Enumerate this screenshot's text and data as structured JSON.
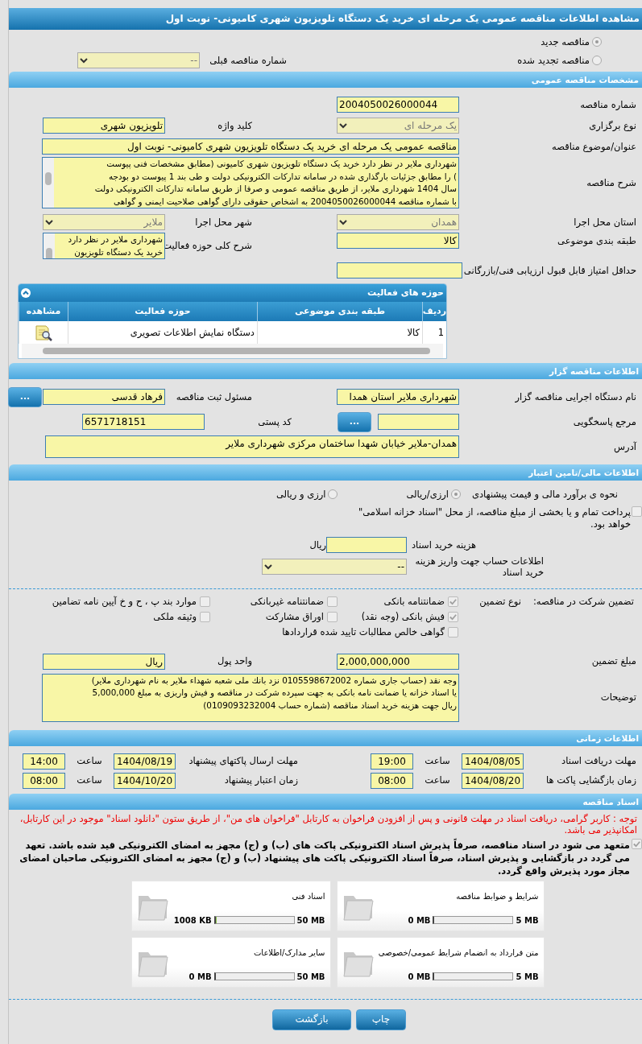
{
  "title": "مشاهده اطلاعات مناقصه عمومی یک مرحله ای خرید یک دستگاه تلویزیون شهری کامیونی- نوبت اول",
  "tender_status": [
    {
      "label": "مناقصه جدید",
      "selected": true
    },
    {
      "label": "مناقصه تجدید شده",
      "selected": false
    }
  ],
  "previous_tender": {
    "label": "شماره مناقصه قبلی",
    "value": "--"
  },
  "general": {
    "heading": "مشخصات مناقصه عمومی",
    "number": {
      "label": "شماره مناقصه",
      "value": "2004050026000044"
    },
    "holding_type": {
      "label": "نوع برگزاری",
      "value": "یک مرحله ای"
    },
    "keyword": {
      "label": "کلید واژه",
      "value": "تلویزیون شهری"
    },
    "subject": {
      "label": "عنوان/موضوع مناقصه",
      "value": "مناقصه عمومی یک مرحله ای  خرید یک دستگاه تلویزیون شهری کامیونی-  نوبت اول"
    },
    "description": {
      "label": "شرح مناقصه",
      "lines": [
        "شهرداری ملایر در نظر دارد  خرید یک دستگاه تلویزیون شهری کامیونی (مطابق مشخصات فنی پیوست",
        ") را مطابق جزئیات بارگذاری شده در سامانه تدارکات الکترونیکی دولت و طی بند 1 پیوست دو بودجه",
        "سال 1404 شهرداری ملایر، از طریق مناقصه عمومی و صرفا از طریق سامانه تدارکات الکترونیکی دولت",
        "با شماره مناقصه 2004050026000044 به اشخاص حقوقی دارای گواهی صلاحیت ایمنی و گواهی"
      ]
    },
    "province": {
      "label": "استان محل اجرا",
      "value": "همدان"
    },
    "city": {
      "label": "شهر محل اجرا",
      "value": "ملایر"
    },
    "category": {
      "label": "طبقه بندی موضوعی",
      "value": "کالا"
    },
    "activity_description": {
      "label": "شرح کلی حوزه فعالیت",
      "lines": [
        "شهرداری ملایر در نظر دارد",
        "خرید یک دستگاه تلویزیون"
      ]
    },
    "min_score": {
      "label": "حداقل امتیاز قابل قبول ارزیابی فنی/بازرگانی"
    },
    "activities": {
      "title": "حوزه های فعالیت",
      "columns": [
        "ردیف",
        "طبقه بندی موضوعی",
        "حوزه فعالیت",
        "مشاهده"
      ],
      "rows": [
        {
          "index": "1",
          "category": "کالا",
          "field": "دستگاه نمایش اطلاعات تصویری"
        }
      ]
    }
  },
  "organizer": {
    "heading": "اطلاعات مناقصه گزار",
    "org": {
      "label": "نام دستگاه اجرایی مناقصه گزار",
      "value": "شهرداری ملایر استان همدا"
    },
    "registrar": {
      "label": "مسئول ثبت مناقصه",
      "value": "فرهاد قدسی",
      "button": "..."
    },
    "reference": {
      "label": "مرجع پاسخگویی",
      "button": "..."
    },
    "postal_code": {
      "label": "کد پستی",
      "value": "6571718151"
    },
    "address": {
      "label": "آدرس",
      "value": "همدان-ملایر خیابان شهدا ساختمان مرکزی شهرداری ملایر"
    }
  },
  "finance": {
    "heading": "اطلاعات مالی/تامین اعتبار",
    "estimate_label": "نحوه ی برآورد مالی و قیمت پیشنهادی",
    "estimate_options": [
      {
        "label": "ارزی/ریالی",
        "selected": true
      },
      {
        "label": "ارزی و ریالی",
        "selected": false
      }
    ],
    "treasury": {
      "label": "پرداخت تمام و یا بخشی از مبلغ مناقصه، از محل \"اسناد خزانه اسلامی\" خواهد بود.",
      "checked": false
    },
    "document_cost": {
      "label": "هزینه خرید اسناد",
      "unit": "ریال"
    },
    "account": {
      "label": "اطلاعات حساب جهت واریز هزینه خرید اسناد",
      "value": "--"
    }
  },
  "guarantee": {
    "label": "تضمین شرکت در مناقصه:",
    "type_label": "نوع تضمین",
    "options": [
      {
        "label": "ضمانتنامه بانکی",
        "checked": true
      },
      {
        "label": "ضمانتنامه غیربانکی",
        "checked": false
      },
      {
        "label": "موارد بند پ ، ح و خ آیین نامه تضامین",
        "checked": false
      },
      {
        "label": "فیش بانکی (وجه نقد)",
        "checked": true
      },
      {
        "label": "اوراق مشارکت",
        "checked": false
      },
      {
        "label": "وثیقه ملکی",
        "checked": false
      },
      {
        "label": "گواهی خالص مطالبات تایید شده قراردادها",
        "checked": false
      }
    ],
    "amount": {
      "label": "مبلغ تضمین",
      "value": "2,000,000,000"
    },
    "currency": {
      "label": "واحد پول",
      "value": "ریال"
    },
    "notes": {
      "label": "توضیحات",
      "lines": [
        "وجه نقد (حساب جاری شماره 0105598672002 نزد بانك ملی شعبه شهداء ملایر به نام شهرداری ملایر)",
        "یا اسناد خزانه یا ضمانت نامه بانکی به جهت سپرده شرکت در مناقصه و فیش واریزی به مبلغ 5,000,000",
        "ریال جهت هزینه خرید اسناد مناقصه (شماره حساب 0109093232004)"
      ]
    }
  },
  "timing": {
    "heading": "اطلاعات زمانی",
    "items": [
      {
        "label": "مهلت دریافت اسناد",
        "date": "1404/08/05",
        "time_label": "ساعت",
        "time": "19:00"
      },
      {
        "label": "مهلت ارسال پاکتهای پیشنهاد",
        "date": "1404/08/19",
        "time_label": "ساعت",
        "time": "14:00"
      },
      {
        "label": "زمان بازگشایی پاکت ها",
        "date": "1404/08/20",
        "time_label": "ساعت",
        "time": "08:00"
      },
      {
        "label": "زمان اعتبار پیشنهاد",
        "date": "1404/10/20",
        "time_label": "ساعت",
        "time": "08:00"
      }
    ]
  },
  "documents": {
    "heading": "اسناد مناقصه",
    "notice": "توجه : کاربر گرامی، دریافت اسناد در مهلت قانونی و پس از افزودن فراخوان به کارتابل \"فراخوان های من\"، از طریق ستون \"دانلود اسناد\" موجود در این کارتابل، امکانپذیر می باشد.",
    "commitment": {
      "text": "متعهد می شود در اسناد مناقصه، صرفاً پذیرش اسناد الکترونیکی پاکت های (ب) و (ج) مجهز به امضای الکترونیکی قید شده باشد. تعهد می گردد در بازگشایی و پذیرش اسناد، صرفاً اسناد الکترونیکی پاکت های پیشنهاد (ب) و (ج) مجهز به امضای الکترونیکی صاحبان امضای مجاز مورد پذیرش واقع گردد.",
      "checked": true
    },
    "files": [
      {
        "title": "شرایط و ضوابط مناقصه",
        "max": "5 MB",
        "size": "0 MB",
        "level": 0
      },
      {
        "title": "اسناد فنی",
        "max": "50 MB",
        "size": "1008 KB",
        "level": 0.02
      },
      {
        "title": "متن قرارداد به انضمام شرایط عمومی/خصوصی",
        "max": "5 MB",
        "size": "0 MB",
        "level": 0
      },
      {
        "title": "سایر مدارک/اطلاعات",
        "max": "50 MB",
        "size": "0 MB",
        "level": 0
      }
    ]
  },
  "buttons": [
    {
      "label": "چاپ",
      "kind": "print"
    },
    {
      "label": "بازگشت",
      "kind": "back"
    }
  ]
}
